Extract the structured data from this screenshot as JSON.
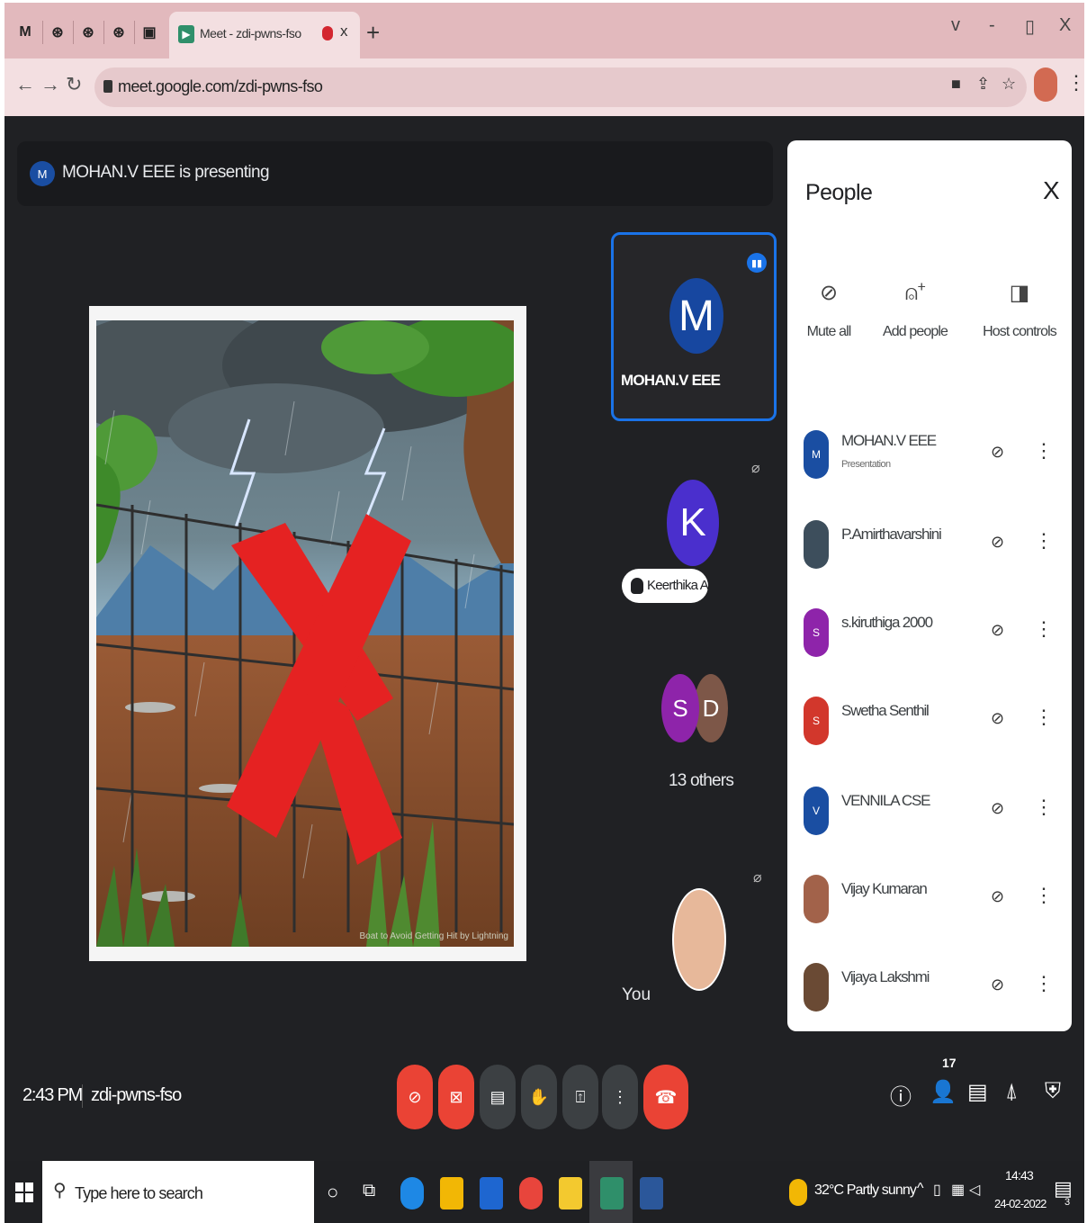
{
  "browser": {
    "tab_title": "Meet - zdi-pwns-fso",
    "tab_close": "x",
    "new_tab": "+",
    "window_controls": {
      "tabsearch": "v",
      "minimize": "-",
      "restore": "▯",
      "close": "X"
    },
    "url": "meet.google.com/zdi-pwns-fso"
  },
  "meet": {
    "presenting_banner": "MOHAN.V EEE is presenting",
    "banner_initial": "M",
    "slide_caption": "Boat to Avoid Getting Hit by Lightning",
    "tiles": [
      {
        "initial": "M",
        "name": "MOHAN.V EEE"
      },
      {
        "initial": "K",
        "name": "Keerthika A"
      },
      {
        "initials": [
          "S",
          "D"
        ],
        "label": "13 others"
      },
      {
        "label": "You"
      }
    ],
    "people_panel": {
      "title": "People",
      "close": "X",
      "actions": [
        {
          "label": "Mute all",
          "icon": "mic-off-icon"
        },
        {
          "label": "Add people",
          "icon": "person-add-icon"
        },
        {
          "label": "Host controls",
          "icon": "host-controls-icon"
        }
      ],
      "participants": [
        {
          "name": "MOHAN.V EEE",
          "role": "Presentation",
          "initial": "M",
          "color": "#1a4ea2"
        },
        {
          "name": "P.Amirthavarshini",
          "role": "",
          "initial": "",
          "color": "#3d4e5c"
        },
        {
          "name": "s.kiruthiga 2000",
          "role": "",
          "initial": "S",
          "color": "#8e24aa"
        },
        {
          "name": "Swetha Senthil",
          "role": "",
          "initial": "S",
          "color": "#d2372c"
        },
        {
          "name": "VENNILA CSE",
          "role": "",
          "initial": "V",
          "color": "#1a4ea2"
        },
        {
          "name": "Vijay Kumaran",
          "role": "",
          "initial": "",
          "color": "#a2624a"
        },
        {
          "name": "Vijaya Lakshmi",
          "role": "",
          "initial": "",
          "color": "#6a4a34"
        }
      ]
    },
    "bottom_bar": {
      "time": "2:43 PM",
      "separator": "|",
      "meeting_code": "zdi-pwns-fso",
      "people_count": "17"
    }
  },
  "taskbar": {
    "search_placeholder": "Type here to search",
    "weather": "32°C  Partly sunny",
    "time": "14:43",
    "date": "24-02-2022",
    "notifications": "3"
  },
  "colors": {
    "meet_bg": "#202124",
    "accent": "#1a73e8",
    "danger": "#ea4335",
    "tab_strip": "#e2b9bd"
  }
}
